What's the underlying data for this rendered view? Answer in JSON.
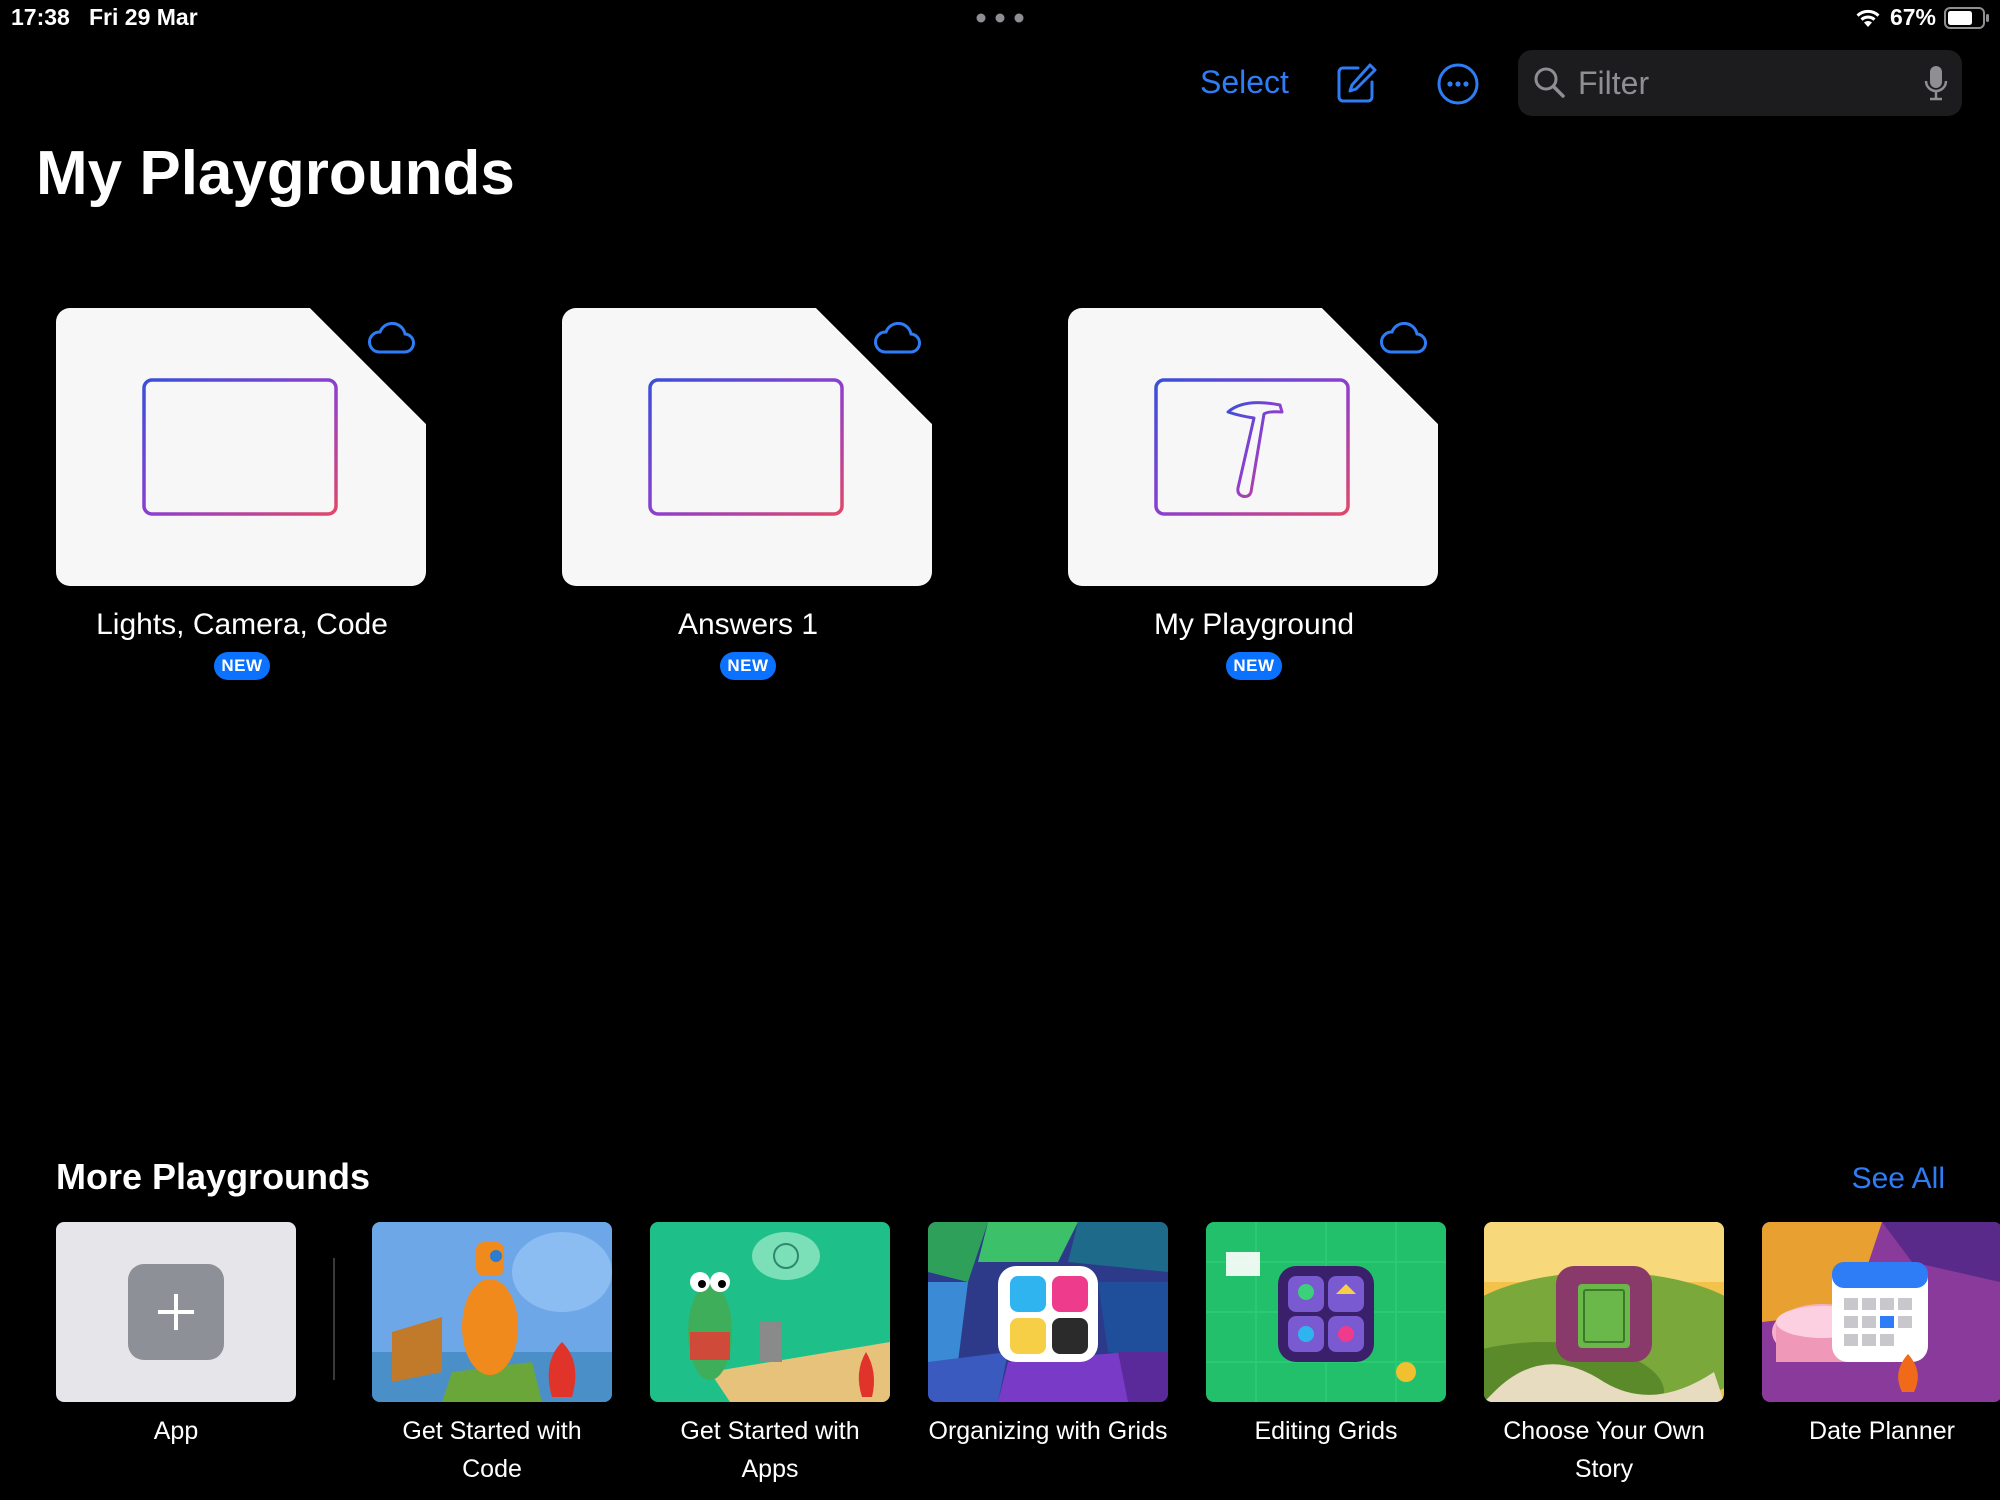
{
  "status_bar": {
    "time": "17:38",
    "date": "Fri 29 Mar",
    "battery": "67%"
  },
  "toolbar": {
    "select_label": "Select",
    "compose_icon": "compose-icon",
    "more_icon": "ellipsis-circle-icon",
    "search_placeholder": "Filter"
  },
  "page_title": "My Playgrounds",
  "playgrounds": [
    {
      "name": "Lights, Camera, Code",
      "badge": "NEW",
      "icon": "blank-frame"
    },
    {
      "name": "Answers 1",
      "badge": "NEW",
      "icon": "blank-frame"
    },
    {
      "name": "My Playground",
      "badge": "NEW",
      "icon": "hammer"
    }
  ],
  "more": {
    "title": "More Playgrounds",
    "see_all": "See All",
    "tiles": [
      {
        "label": "App"
      },
      {
        "label": "Get Started with Code"
      },
      {
        "label": "Get Started with Apps"
      },
      {
        "label": "Organizing with Grids"
      },
      {
        "label": "Editing Grids"
      },
      {
        "label": "Choose Your Own Story"
      },
      {
        "label": "Date Planner"
      }
    ]
  },
  "colors": {
    "accent": "#2e7cf6",
    "badge": "#0a72ff",
    "background": "#000000"
  }
}
